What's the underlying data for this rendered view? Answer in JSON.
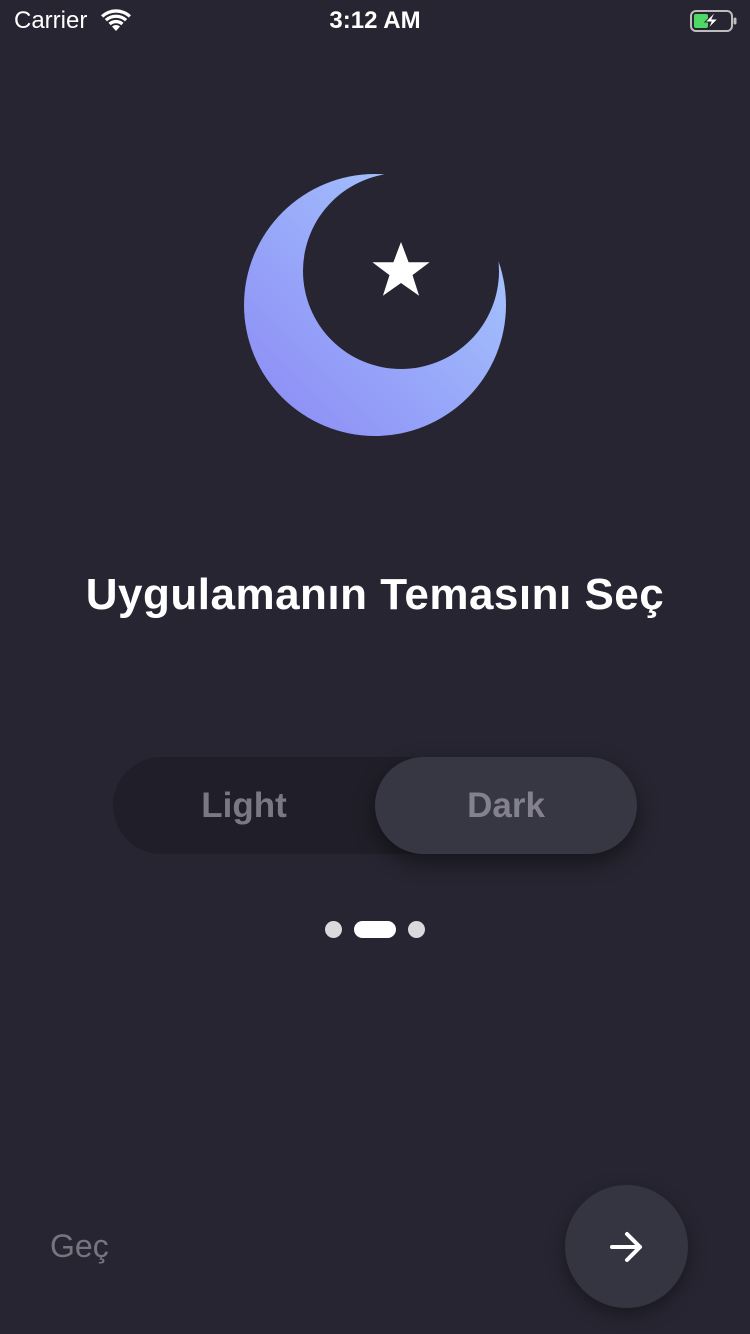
{
  "status_bar": {
    "carrier": "Carrier",
    "time": "3:12 AM",
    "icons": [
      "wifi-icon",
      "battery-charging-icon"
    ]
  },
  "illustration": {
    "icon": "crescent-moon-star-icon",
    "gradient_start": "#a7c9ff",
    "gradient_end": "#8b8cf5"
  },
  "title": "Uygulamanın Temasını Seç",
  "theme_toggle": {
    "options": [
      {
        "label": "Light",
        "selected": false
      },
      {
        "label": "Dark",
        "selected": true
      }
    ]
  },
  "pagination": {
    "count": 3,
    "active_index": 1
  },
  "footer": {
    "skip_label": "Geç",
    "next_icon": "arrow-right-icon"
  },
  "colors": {
    "background": "#262531",
    "toggle_track": "#201f29",
    "toggle_selected": "#373643",
    "next_button": "#353441"
  }
}
